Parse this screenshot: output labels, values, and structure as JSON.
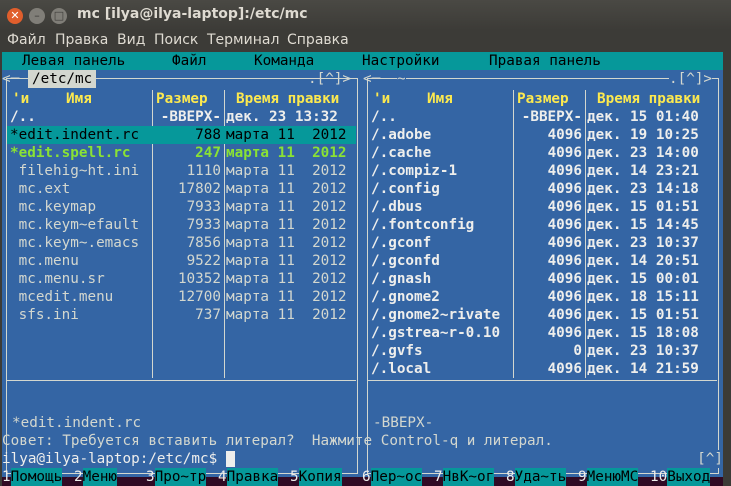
{
  "window": {
    "title": "mc [ilya@ilya-laptop]:/etc/mc"
  },
  "menu": [
    "Файл",
    "Правка",
    "Вид",
    "Поиск",
    "Терминал",
    "Справка"
  ],
  "mc_menu": [
    "Левая панель",
    "Файл",
    "Команда",
    "Настройки",
    "Правая панель"
  ],
  "left_panel": {
    "path": "/etc/mc",
    "corner": ".[^]>",
    "headers": {
      "n": "'и",
      "name": "Имя",
      "size": "Размер",
      "time": "Время правки"
    },
    "rows": [
      {
        "name": "/..",
        "size": "-ВВЕРХ-",
        "time": "дек. 23 13:32",
        "style": "white"
      },
      {
        "name": "*edit.indent.rc",
        "size": "788",
        "time": "марта 11  2012",
        "style": "sel"
      },
      {
        "name": "*edit.spell.rc",
        "size": "247",
        "time": "марта 11  2012",
        "style": "green"
      },
      {
        "name": " filehig~ht.ini",
        "size": "1110",
        "time": "марта 11  2012",
        "style": "normal"
      },
      {
        "name": " mc.ext",
        "size": "17802",
        "time": "марта 11  2012",
        "style": "normal"
      },
      {
        "name": " mc.keymap",
        "size": "7933",
        "time": "марта 11  2012",
        "style": "normal"
      },
      {
        "name": " mc.keym~efault",
        "size": "7933",
        "time": "марта 11  2012",
        "style": "normal"
      },
      {
        "name": " mc.keym~.emacs",
        "size": "7856",
        "time": "марта 11  2012",
        "style": "normal"
      },
      {
        "name": " mc.menu",
        "size": "9522",
        "time": "марта 11  2012",
        "style": "normal"
      },
      {
        "name": " mc.menu.sr",
        "size": "10352",
        "time": "марта 11  2012",
        "style": "normal"
      },
      {
        "name": " mcedit.menu",
        "size": "12700",
        "time": "марта 11  2012",
        "style": "normal"
      },
      {
        "name": " sfs.ini",
        "size": "737",
        "time": "марта 11  2012",
        "style": "normal"
      }
    ],
    "status": "*edit.indent.rc"
  },
  "right_panel": {
    "path": "~",
    "corner": ".[^]>",
    "headers": {
      "n": "'и",
      "name": "Имя",
      "size": "Размер",
      "time": "Время правки"
    },
    "rows": [
      {
        "name": "/..",
        "size": "-ВВЕРХ-",
        "time": "дек. 15 01:40",
        "style": "white"
      },
      {
        "name": "/.adobe",
        "size": "4096",
        "time": "дек. 19 10:25",
        "style": "white"
      },
      {
        "name": "/.cache",
        "size": "4096",
        "time": "дек. 23 14:00",
        "style": "white"
      },
      {
        "name": "/.compiz-1",
        "size": "4096",
        "time": "дек. 14 23:21",
        "style": "white"
      },
      {
        "name": "/.config",
        "size": "4096",
        "time": "дек. 23 14:18",
        "style": "white"
      },
      {
        "name": "/.dbus",
        "size": "4096",
        "time": "дек. 15 01:51",
        "style": "white"
      },
      {
        "name": "/.fontconfig",
        "size": "4096",
        "time": "дек. 15 14:45",
        "style": "white"
      },
      {
        "name": "/.gconf",
        "size": "4096",
        "time": "дек. 23 10:37",
        "style": "white"
      },
      {
        "name": "/.gconfd",
        "size": "4096",
        "time": "дек. 14 20:51",
        "style": "white"
      },
      {
        "name": "/.gnash",
        "size": "4096",
        "time": "дек. 15 00:01",
        "style": "white"
      },
      {
        "name": "/.gnome2",
        "size": "4096",
        "time": "дек. 18 15:11",
        "style": "white"
      },
      {
        "name": "/.gnome2~rivate",
        "size": "4096",
        "time": "дек. 15 01:51",
        "style": "white"
      },
      {
        "name": "/.gstrea~r-0.10",
        "size": "4096",
        "time": "дек. 15 18:08",
        "style": "white"
      },
      {
        "name": "/.gvfs",
        "size": "0",
        "time": "дек. 23 10:37",
        "style": "white"
      },
      {
        "name": "/.local",
        "size": "4096",
        "time": "дек. 14 21:59",
        "style": "white"
      }
    ],
    "status": "-ВВЕРХ-"
  },
  "hint": "Совет: Требуется вставить литерал?  Нажмите Control-q и литерал.",
  "prompt": "ilya@ilya-laptop:/etc/mc$ ",
  "scroll_indicator": "[^]",
  "fkeys": [
    {
      "n": "1",
      "label": "Помощь"
    },
    {
      "n": "2",
      "label": "Меню"
    },
    {
      "n": "3",
      "label": "Про~тр"
    },
    {
      "n": "4",
      "label": "Правка"
    },
    {
      "n": "5",
      "label": "Копия"
    },
    {
      "n": "6",
      "label": "Пер~ос"
    },
    {
      "n": "7",
      "label": "НвК~ог"
    },
    {
      "n": "8",
      "label": "Уда~ть"
    },
    {
      "n": "9",
      "label": "МенюMC"
    },
    {
      "n": "10",
      "label": "Выход"
    }
  ]
}
